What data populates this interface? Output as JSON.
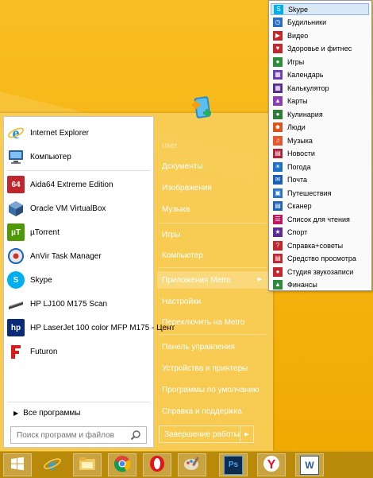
{
  "programs": [
    {
      "label": "Internet Explorer",
      "icon": "internet-explorer-icon",
      "color": "#1e90d8"
    },
    {
      "label": "Компьютер",
      "icon": "computer-icon",
      "color": "#3a7bd5"
    },
    {
      "label": "Aida64 Extreme Edition",
      "icon": "aida64-icon",
      "color": "#c0262d"
    },
    {
      "label": "Oracle VM VirtualBox",
      "icon": "virtualbox-icon",
      "color": "#3a6ea5"
    },
    {
      "label": "µTorrent",
      "icon": "utorrent-icon",
      "color": "#4e9a06"
    },
    {
      "label": "AnVir Task Manager",
      "icon": "anvir-icon",
      "color": "#1565c0"
    },
    {
      "label": "Skype",
      "icon": "skype-icon",
      "color": "#00aff0"
    },
    {
      "label": "HP LJ100 M175 Scan",
      "icon": "scanner-icon",
      "color": "#555555"
    },
    {
      "label": "HP LaserJet 100 color MFP M175 - Цент",
      "icon": "hp-printer-icon",
      "color": "#0a2a7a"
    },
    {
      "label": "Futuron",
      "icon": "futuron-icon",
      "color": "#d81b1b"
    }
  ],
  "all_programs": "Все программы",
  "search": {
    "placeholder": "Поиск программ и файлов"
  },
  "user": {
    "name": "user"
  },
  "right_menu": [
    {
      "label": "Документы"
    },
    {
      "label": "Изображения"
    },
    {
      "label": "Музыка"
    },
    {
      "label": "Игры"
    },
    {
      "label": "Компьютер"
    },
    {
      "label": "Приложения Metro"
    },
    {
      "label": "Настройки"
    },
    {
      "label": "Переключить на Metro"
    },
    {
      "label": "Панель управления"
    },
    {
      "label": "Устройства и принтеры"
    },
    {
      "label": "Программы по умолчанию"
    },
    {
      "label": "Справка и поддержка"
    }
  ],
  "shutdown": {
    "label": "Завершение работы"
  },
  "metro_apps": [
    {
      "label": "Skype",
      "color": "#00aff0"
    },
    {
      "label": "Будильники",
      "color": "#2a6fbf"
    },
    {
      "label": "Видео",
      "color": "#c1272d"
    },
    {
      "label": "Здоровье и фитнес",
      "color": "#c1272d"
    },
    {
      "label": "Игры",
      "color": "#2e8b3d"
    },
    {
      "label": "Календарь",
      "color": "#6a3fb0"
    },
    {
      "label": "Калькулятор",
      "color": "#5b2b91"
    },
    {
      "label": "Карты",
      "color": "#8b3fb5"
    },
    {
      "label": "Кулинария",
      "color": "#2f7d3a"
    },
    {
      "label": "Люди",
      "color": "#d9541e"
    },
    {
      "label": "Музыка",
      "color": "#e8572d"
    },
    {
      "label": "Новости",
      "color": "#b0213a"
    },
    {
      "label": "Погода",
      "color": "#1f6fc5"
    },
    {
      "label": "Почта",
      "color": "#1a5fb4"
    },
    {
      "label": "Путешествия",
      "color": "#2a73c9"
    },
    {
      "label": "Сканер",
      "color": "#1e64b5"
    },
    {
      "label": "Список для чтения",
      "color": "#c2185b"
    },
    {
      "label": "Спорт",
      "color": "#5b2b91"
    },
    {
      "label": "Справка+советы",
      "color": "#c1272d"
    },
    {
      "label": "Средство просмотра",
      "color": "#c1272d"
    },
    {
      "label": "Студия звукозаписи",
      "color": "#c1272d"
    },
    {
      "label": "Финансы",
      "color": "#2e8b3d"
    }
  ],
  "taskbar": [
    {
      "icon": "windows-start-icon"
    },
    {
      "icon": "internet-explorer-icon"
    },
    {
      "icon": "file-explorer-icon"
    },
    {
      "icon": "chrome-icon"
    },
    {
      "icon": "opera-icon"
    },
    {
      "icon": "paint-icon"
    },
    {
      "icon": "photoshop-icon"
    },
    {
      "icon": "yandex-browser-icon"
    },
    {
      "icon": "word-icon"
    }
  ],
  "taskbar_text": {
    "photoshop": "Ps",
    "word": "W"
  }
}
